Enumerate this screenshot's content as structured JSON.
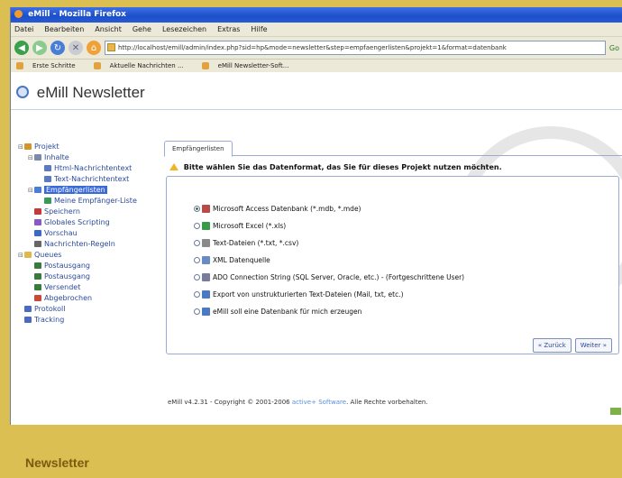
{
  "browser": {
    "window_title": "eMill - Mozilla Firefox",
    "menu": [
      "Datei",
      "Bearbeiten",
      "Ansicht",
      "Gehe",
      "Lesezeichen",
      "Extras",
      "Hilfe"
    ],
    "url": "http://localhost/emill/admin/index.php?sid=hp&mode=newsletter&step=empfaengerlisten&projekt=1&format=datenbank",
    "go_label": "Go",
    "bookmarks": [
      "Erste Schritte",
      "Aktuelle Nachrichten ...",
      "eMill Newsletter-Soft..."
    ]
  },
  "app": {
    "title": "eMill Newsletter"
  },
  "tree": {
    "items": [
      {
        "label": "Projekt",
        "depth": 0,
        "toggle": "⊟",
        "color": "#d6932a"
      },
      {
        "label": "Inhalte",
        "depth": 1,
        "toggle": "⊟",
        "color": "#7a8aa8"
      },
      {
        "label": "Html-Nachrichtentext",
        "depth": 2,
        "toggle": "",
        "color": "#5a7ac4"
      },
      {
        "label": "Text-Nachrichtentext",
        "depth": 2,
        "toggle": "",
        "color": "#5a7ac4"
      },
      {
        "label": "Empfängerlisten",
        "depth": 1,
        "toggle": "⊟",
        "color": "#4a7dd8",
        "selected": true
      },
      {
        "label": "Meine Empfänger-Liste",
        "depth": 2,
        "toggle": "",
        "color": "#3a9a5a"
      },
      {
        "label": "Speichern",
        "depth": 1,
        "toggle": "",
        "color": "#c43a3a"
      },
      {
        "label": "Globales Scripting",
        "depth": 1,
        "toggle": "",
        "color": "#8a5ac4"
      },
      {
        "label": "Vorschau",
        "depth": 1,
        "toggle": "",
        "color": "#3a6ac4"
      },
      {
        "label": "Nachrichten-Regeln",
        "depth": 1,
        "toggle": "",
        "color": "#666666"
      },
      {
        "label": "Queues",
        "depth": 0,
        "toggle": "⊟",
        "color": "#e2b84a"
      },
      {
        "label": "Postausgang",
        "depth": 1,
        "toggle": "",
        "color": "#3a7a3a"
      },
      {
        "label": "Postausgang",
        "depth": 1,
        "toggle": "",
        "color": "#3a7a3a"
      },
      {
        "label": "Versendet",
        "depth": 1,
        "toggle": "",
        "color": "#3a7a3a"
      },
      {
        "label": "Abgebrochen",
        "depth": 1,
        "toggle": "",
        "color": "#c44a3a"
      },
      {
        "label": "Protokoll",
        "depth": 0,
        "toggle": "",
        "color": "#4a6ac4"
      },
      {
        "label": "Tracking",
        "depth": 0,
        "toggle": "",
        "color": "#4a6ac4"
      }
    ]
  },
  "wizard": {
    "tab_label": "Empfängerlisten",
    "prompt": "Bitte wählen Sie das Datenformat, das Sie für dieses Projekt nutzen möchten.",
    "options": [
      {
        "label": "Microsoft Access Datenbank (*.mdb, *.mde)",
        "selected": true,
        "icon": "#b84a4a"
      },
      {
        "label": "Microsoft Excel (*.xls)",
        "selected": false,
        "icon": "#3a9a4a"
      },
      {
        "label": "Text-Dateien (*.txt, *.csv)",
        "selected": false,
        "icon": "#8a8a8a"
      },
      {
        "label": "XML Datenquelle",
        "selected": false,
        "icon": "#6a8ac4"
      },
      {
        "label": "ADO Connection String (SQL Server, Oracle, etc.) - (Fortgeschrittene User)",
        "selected": false,
        "icon": "#7a7a9a"
      },
      {
        "label": "Export von unstrukturierten Text-Dateien (Mail, txt, etc.)",
        "selected": false,
        "icon": "#4a7ac4"
      },
      {
        "label": "eMill soll eine Datenbank für mich erzeugen",
        "selected": false,
        "icon": "#4a7ac4"
      }
    ],
    "back_label": "« Zurück",
    "next_label": "Weiter »"
  },
  "footer": {
    "prefix": "eMill v4.2.31 - Copyright © 2001-2006 ",
    "brand": "active+ Software",
    "suffix": ". Alle Rechte vorbehalten."
  },
  "caption": "Newsletter"
}
